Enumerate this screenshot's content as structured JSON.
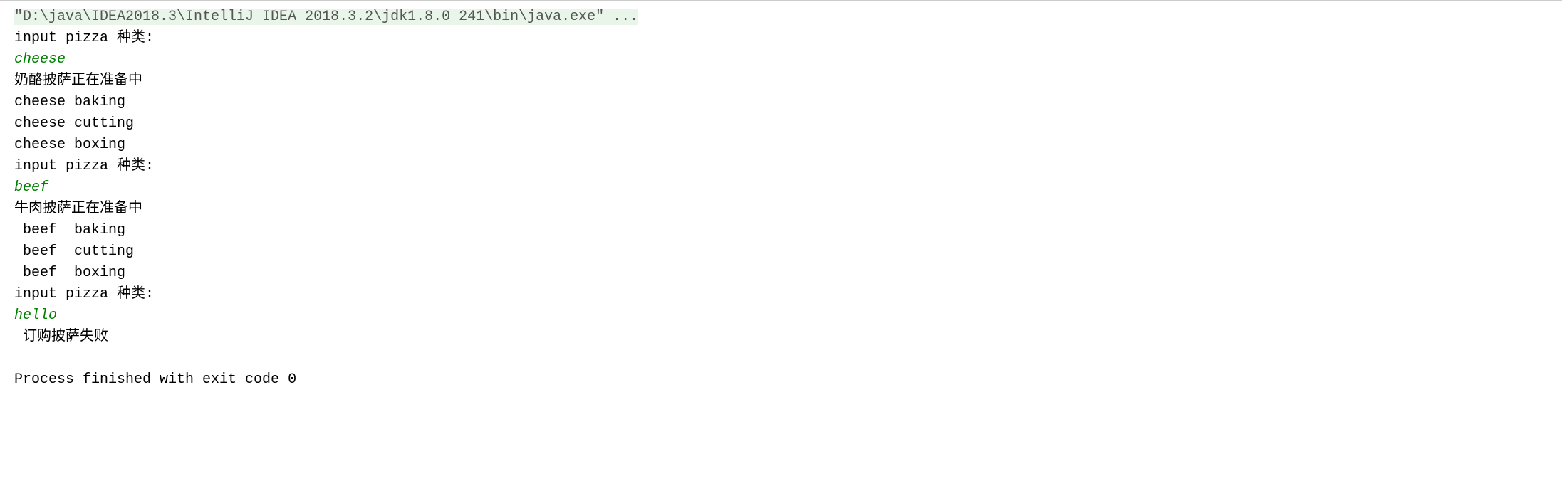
{
  "console": {
    "command": "\"D:\\java\\IDEA2018.3\\IntelliJ IDEA 2018.3.2\\jdk1.8.0_241\\bin\\java.exe\" ...",
    "lines": [
      {
        "type": "output",
        "text": "input pizza 种类:"
      },
      {
        "type": "input",
        "text": "cheese"
      },
      {
        "type": "output",
        "text": "奶酪披萨正在准备中"
      },
      {
        "type": "output",
        "text": "cheese baking"
      },
      {
        "type": "output",
        "text": "cheese cutting"
      },
      {
        "type": "output",
        "text": "cheese boxing"
      },
      {
        "type": "output",
        "text": "input pizza 种类:"
      },
      {
        "type": "input",
        "text": "beef"
      },
      {
        "type": "output",
        "text": "牛肉披萨正在准备中"
      },
      {
        "type": "output",
        "text": " beef  baking"
      },
      {
        "type": "output",
        "text": " beef  cutting"
      },
      {
        "type": "output",
        "text": " beef  boxing"
      },
      {
        "type": "output",
        "text": "input pizza 种类:"
      },
      {
        "type": "input",
        "text": "hello"
      },
      {
        "type": "output",
        "text": " 订购披萨失败"
      },
      {
        "type": "blank",
        "text": ""
      },
      {
        "type": "process",
        "text": "Process finished with exit code 0"
      }
    ]
  }
}
